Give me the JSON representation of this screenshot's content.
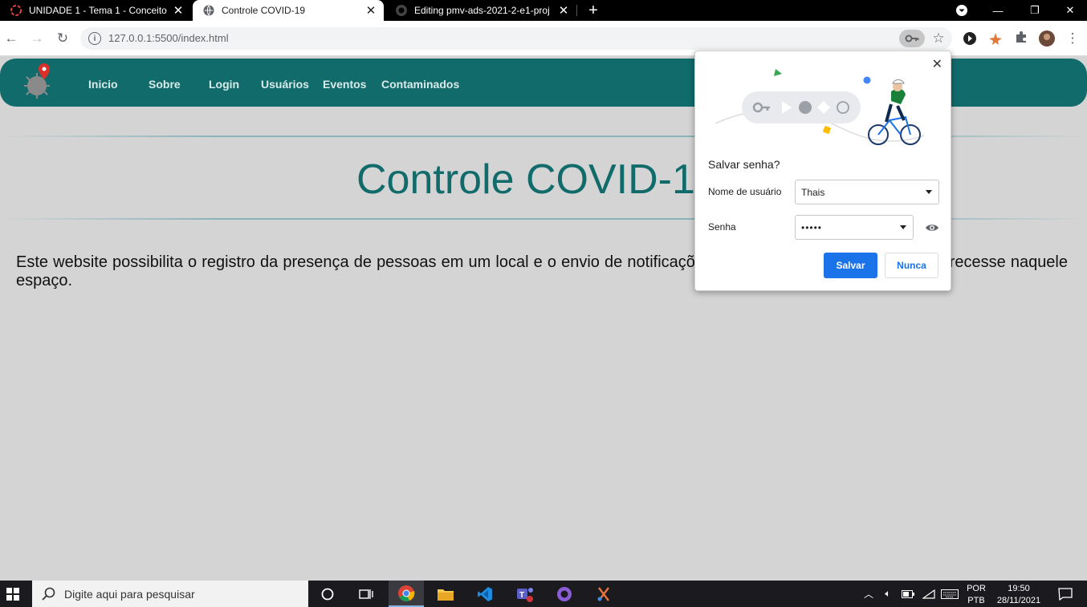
{
  "browser": {
    "tabs": [
      {
        "label": "UNIDADE 1 - Tema 1 - Conceito",
        "active": false,
        "icon": "loading-ring-icon"
      },
      {
        "label": "Controle COVID-19",
        "active": true,
        "icon": "globe-icon"
      },
      {
        "label": "Editing pmv-ads-2021-2-e1-proj",
        "active": false,
        "icon": "github-icon"
      }
    ],
    "new_tab": "+",
    "url": "127.0.0.1:5500/index.html",
    "window_controls": {
      "minimize": "—",
      "maximize": "❐",
      "close": "✕"
    }
  },
  "page": {
    "nav": [
      "Inicio",
      "Sobre",
      "Login",
      "Usuários",
      "Eventos",
      "Contaminados"
    ],
    "title": "Controle COVID-19",
    "description": "Este website possibilita o registro da presença de pessoas em um local e o envio de notificações caso algum contaminado comparecesse naquele espaço.",
    "colors": {
      "nav_bg": "#116b6b",
      "title": "#116b6b",
      "page_bg": "#d4d4d4"
    }
  },
  "password_bubble": {
    "title": "Salvar senha?",
    "username_label": "Nome de usuário",
    "username_value": "Thais",
    "password_label": "Senha",
    "password_value": "•••••",
    "save_label": "Salvar",
    "never_label": "Nunca",
    "close": "✕",
    "colors": {
      "primary": "#1a73e8"
    }
  },
  "taskbar": {
    "search_placeholder": "Digite aqui para pesquisar",
    "language": {
      "line1": "POR",
      "line2": "PTB"
    },
    "time": "19:50",
    "date": "28/11/2021",
    "apps": [
      "cortana-icon",
      "task-view-icon",
      "chrome-icon",
      "file-explorer-icon",
      "vscode-icon",
      "teams-icon",
      "github-desktop-icon",
      "snip-icon"
    ]
  }
}
